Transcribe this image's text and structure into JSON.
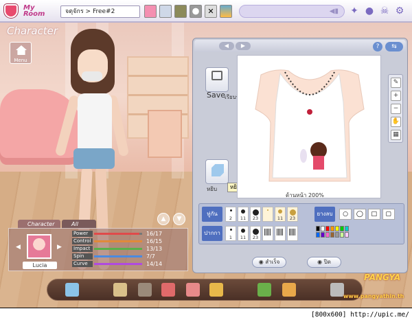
{
  "topbar": {
    "logo_text": "My\nRoom",
    "breadcrumb": "จตุจักร > Free#2"
  },
  "page": {
    "title": "Character",
    "menu_label": "Menu"
  },
  "stats_panel": {
    "tab_character": "Character",
    "tab_all": "All",
    "avatar_name": "Lucia",
    "stats": [
      {
        "label": "Power",
        "value": "16/17",
        "color": "#e04a4a",
        "fill": 0.94
      },
      {
        "label": "Control",
        "value": "16/15",
        "color": "#e08a3a",
        "fill": 1.0
      },
      {
        "label": "Impact",
        "value": "13/13",
        "color": "#5ab04a",
        "fill": 1.0
      },
      {
        "label": "Spin",
        "value": "7/7",
        "color": "#4a8ae0",
        "fill": 1.0
      },
      {
        "label": "Curve",
        "value": "14/14",
        "color": "#b04ae0",
        "fill": 1.0
      }
    ]
  },
  "designer": {
    "save_label": "Save",
    "save_caption": "เรียบร้อย",
    "pick_caption": "หยิบ",
    "tooltip": "หยิบ",
    "zoom_label": "ด้านหน้า",
    "zoom_value": "200%",
    "row1_label": "ทู่กัน",
    "row2_label": "ปากกา",
    "eraser_label": "ยางลบ",
    "row1_sizes": [
      "2",
      "11",
      "23",
      "",
      "11",
      "23"
    ],
    "row2_sizes": [
      "1",
      "11",
      "23",
      "",
      "",
      ""
    ],
    "ok_label": "สำเร็จ",
    "close_label": "ปิด",
    "palette_colors": [
      "#000000",
      "#ffffff",
      "#ff0000",
      "#ff9900",
      "#ffff00",
      "#00cc00",
      "#00cccc",
      "#0066ff",
      "#6600cc",
      "#ff66cc",
      "#996633",
      "#999999",
      "#ccff99",
      "#ffccff"
    ]
  },
  "branding": {
    "game_name": "PANGYA",
    "url": "www.pangyathin.th"
  },
  "footer": {
    "caption": "[800x600] http://upic.me/"
  }
}
